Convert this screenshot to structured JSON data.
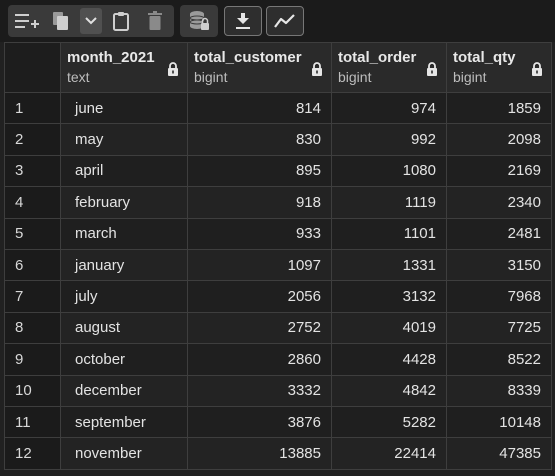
{
  "colors": {
    "background": "#212121",
    "toolbar_group": "#3a3a3a",
    "grid_border": "#3e3e3e"
  },
  "toolbar": {
    "buttons": [
      {
        "icon": "add-rows-icon"
      },
      {
        "icon": "copy-icon"
      },
      {
        "icon": "chevron-down-icon"
      },
      {
        "icon": "clipboard-icon"
      },
      {
        "icon": "trash-icon"
      },
      {
        "icon": "database-lock-icon"
      },
      {
        "icon": "download-icon"
      },
      {
        "icon": "line-chart-icon"
      }
    ]
  },
  "columns": [
    {
      "name": "month_2021",
      "type": "text",
      "lock_icon": "lock-icon"
    },
    {
      "name": "total_customer",
      "type": "bigint",
      "lock_icon": "lock-icon"
    },
    {
      "name": "total_order",
      "type": "bigint",
      "lock_icon": "lock-icon"
    },
    {
      "name": "total_qty",
      "type": "bigint",
      "lock_icon": "lock-icon"
    }
  ],
  "rows": [
    {
      "n": "1",
      "month": "june",
      "customer": "814",
      "order": "974",
      "qty": "1859"
    },
    {
      "n": "2",
      "month": "may",
      "customer": "830",
      "order": "992",
      "qty": "2098"
    },
    {
      "n": "3",
      "month": "april",
      "customer": "895",
      "order": "1080",
      "qty": "2169"
    },
    {
      "n": "4",
      "month": "february",
      "customer": "918",
      "order": "1119",
      "qty": "2340"
    },
    {
      "n": "5",
      "month": "march",
      "customer": "933",
      "order": "1101",
      "qty": "2481"
    },
    {
      "n": "6",
      "month": "january",
      "customer": "1097",
      "order": "1331",
      "qty": "3150"
    },
    {
      "n": "7",
      "month": "july",
      "customer": "2056",
      "order": "3132",
      "qty": "7968"
    },
    {
      "n": "8",
      "month": "august",
      "customer": "2752",
      "order": "4019",
      "qty": "7725"
    },
    {
      "n": "9",
      "month": "october",
      "customer": "2860",
      "order": "4428",
      "qty": "8522"
    },
    {
      "n": "10",
      "month": "december",
      "customer": "3332",
      "order": "4842",
      "qty": "8339"
    },
    {
      "n": "11",
      "month": "september",
      "customer": "3876",
      "order": "5282",
      "qty": "10148"
    },
    {
      "n": "12",
      "month": "november",
      "customer": "13885",
      "order": "22414",
      "qty": "47385"
    }
  ]
}
